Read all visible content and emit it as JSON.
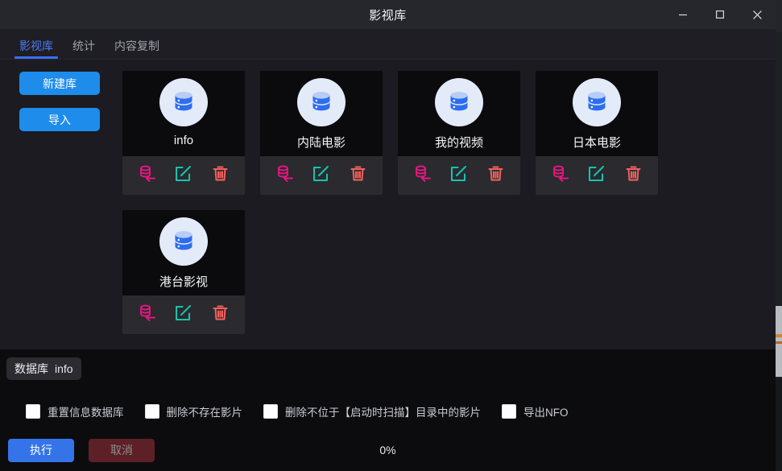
{
  "window": {
    "title": "影视库",
    "controls": {
      "minimize": "minimize-icon",
      "maximize": "maximize-icon",
      "close": "close-icon"
    }
  },
  "tabs": [
    {
      "label": "影视库",
      "active": true
    },
    {
      "label": "统计",
      "active": false
    },
    {
      "label": "内容复制",
      "active": false
    }
  ],
  "sidebar": {
    "buttons": [
      {
        "label": "新建库",
        "name": "new-library-button"
      },
      {
        "label": "导入",
        "name": "import-button"
      }
    ]
  },
  "libraries": [
    {
      "name": "info",
      "icon": "database-icon"
    },
    {
      "name": "内陆电影",
      "icon": "database-icon"
    },
    {
      "name": "我的视频",
      "icon": "database-icon"
    },
    {
      "name": "日本电影",
      "icon": "database-icon"
    },
    {
      "name": "港台影视",
      "icon": "database-icon"
    }
  ],
  "card_actions": [
    {
      "name": "database-import-icon",
      "title": "导入数据库",
      "color": "#e5177f"
    },
    {
      "name": "edit-icon",
      "title": "编辑",
      "color": "#16c4ae"
    },
    {
      "name": "trash-icon",
      "title": "删除",
      "color": "#f4615c"
    }
  ],
  "bottom_panel": {
    "db_chip": {
      "label": "数据库",
      "value": "info"
    },
    "options": [
      {
        "label": "重置信息数据库",
        "checked": false
      },
      {
        "label": "删除不存在影片",
        "checked": false
      },
      {
        "label": "删除不位于【启动时扫描】目录中的影片",
        "checked": false
      },
      {
        "label": "导出NFO",
        "checked": false
      }
    ],
    "execute_button": "执行",
    "cancel_button": "取消",
    "progress": "0%"
  },
  "colors": {
    "accent_blue": "#3b6ef3",
    "button_blue": "#1e8cea",
    "pink": "#e5177f",
    "teal": "#16c4ae",
    "red": "#f4615c",
    "cancel_red": "#5c2026",
    "window_bg": "#1b1b21",
    "titlebar_bg": "#25272d",
    "card_bg": "#0b0b0d",
    "card_action_bg": "#2a2a2f",
    "panel_bg": "#0c0c0f"
  }
}
